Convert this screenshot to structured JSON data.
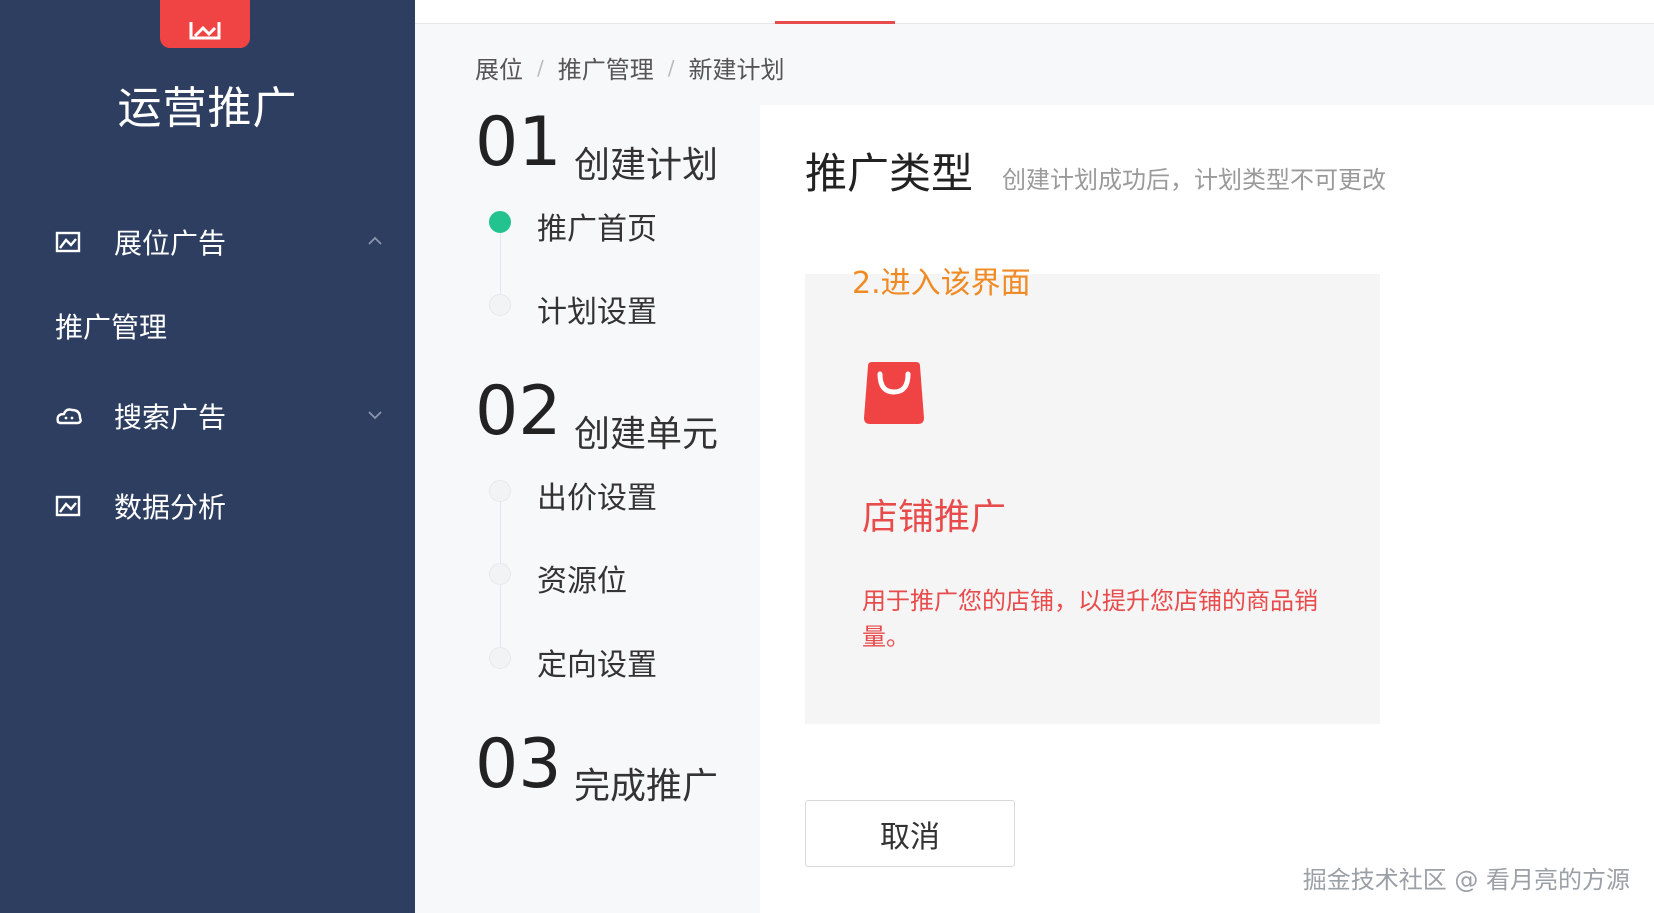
{
  "sidebar": {
    "app_title": "运营推广",
    "menu": [
      {
        "label": "展位广告",
        "icon": "picture-icon",
        "expanded": true
      },
      {
        "label": "推广管理"
      },
      {
        "label": "搜索广告",
        "icon": "cloud-icon",
        "expanded": false
      },
      {
        "label": "数据分析",
        "icon": "picture-icon"
      }
    ]
  },
  "breadcrumb": [
    "展位",
    "推广管理",
    "新建计划"
  ],
  "steps": [
    {
      "num": "01",
      "title": "创建计划",
      "items": [
        "推广首页",
        "计划设置"
      ],
      "active_item": 0
    },
    {
      "num": "02",
      "title": "创建单元",
      "items": [
        "出价设置",
        "资源位",
        "定向设置"
      ]
    },
    {
      "num": "03",
      "title": "完成推广"
    }
  ],
  "main": {
    "title": "推广类型",
    "subtitle": "创建计划成功后，计划类型不可更改",
    "annotation": "2.进入该界面",
    "card": {
      "icon": "shopping-bag-icon",
      "title": "店铺推广",
      "desc": "用于推广您的店铺，以提升您店铺的商品销量。"
    },
    "cancel_label": "取消"
  },
  "watermark": "掘金技术社区 @ 看月亮的方源",
  "colors": {
    "sidebar_bg": "#2d3e60",
    "brand_red": "#e84b4b",
    "active_green": "#22c38e",
    "annotation_orange": "#f08a24"
  }
}
